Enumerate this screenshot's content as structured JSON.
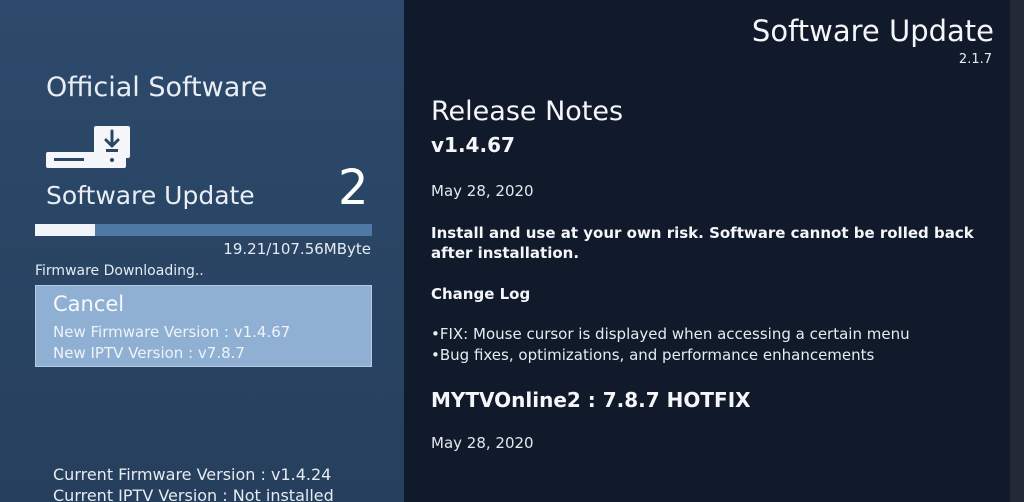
{
  "left": {
    "title": "Official Software",
    "device_icon": "set-top-box-download-icon",
    "update_label": "Software Update",
    "step_number": "2",
    "progress": {
      "text": "19.21/107.56MByte",
      "fraction": 0.179
    },
    "status": "Firmware Downloading..",
    "cancel": {
      "label": "Cancel",
      "new_firmware": "New Firmware Version : v1.4.67",
      "new_iptv": "New IPTV Version : v7.8.7"
    },
    "current_firmware": "Current Firmware Version : v1.4.24",
    "current_iptv": "Current IPTV Version : Not installed"
  },
  "right": {
    "app_title": "Software Update",
    "app_version": "2.1.7",
    "release_notes_title": "Release Notes",
    "release_version": "v1.4.67",
    "release_date": "May 28, 2020",
    "warning": "Install and use at your own risk. Software cannot be rolled back after installation.",
    "changelog_title": "Change Log",
    "changelog": [
      "FIX: Mouse cursor is displayed when accessing a certain menu",
      "Bug fixes, optimizations, and performance enhancements"
    ],
    "second_title": "MYTVOnline2 : 7.8.7 HOTFIX",
    "second_date": "May 28, 2020"
  },
  "colors": {
    "left_panel": "#2a4565",
    "right_panel": "#111a2b",
    "progress_track": "#4f78a6",
    "progress_fill": "#f1f4f8",
    "cancel_highlight": "#8fb0d3"
  }
}
